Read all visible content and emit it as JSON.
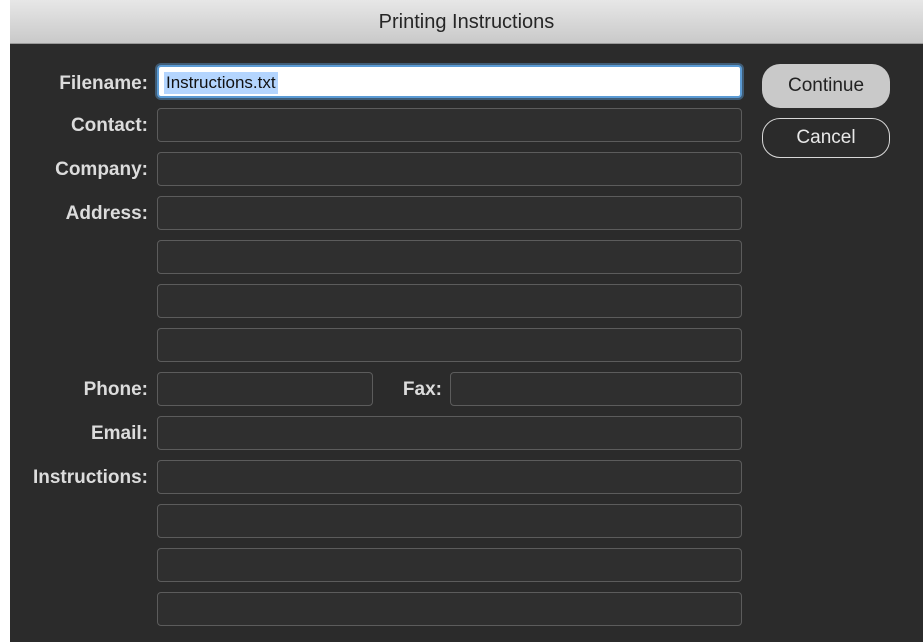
{
  "dialog": {
    "title": "Printing Instructions"
  },
  "labels": {
    "filename": "Filename:",
    "contact": "Contact:",
    "company": "Company:",
    "address": "Address:",
    "phone": "Phone:",
    "fax": "Fax:",
    "email": "Email:",
    "instructions": "Instructions:"
  },
  "fields": {
    "filename": "Instructions.txt",
    "contact": "",
    "company": "",
    "address_1": "",
    "address_2": "",
    "address_3": "",
    "address_4": "",
    "phone": "",
    "fax": "",
    "email": "",
    "instructions_1": "",
    "instructions_2": "",
    "instructions_3": "",
    "instructions_4": ""
  },
  "buttons": {
    "continue": "Continue",
    "cancel": "Cancel"
  },
  "colors": {
    "dialog_background": "#2b2b2b",
    "focus_ring": "#5b9bd5",
    "text_selection": "#b4d5fe"
  }
}
